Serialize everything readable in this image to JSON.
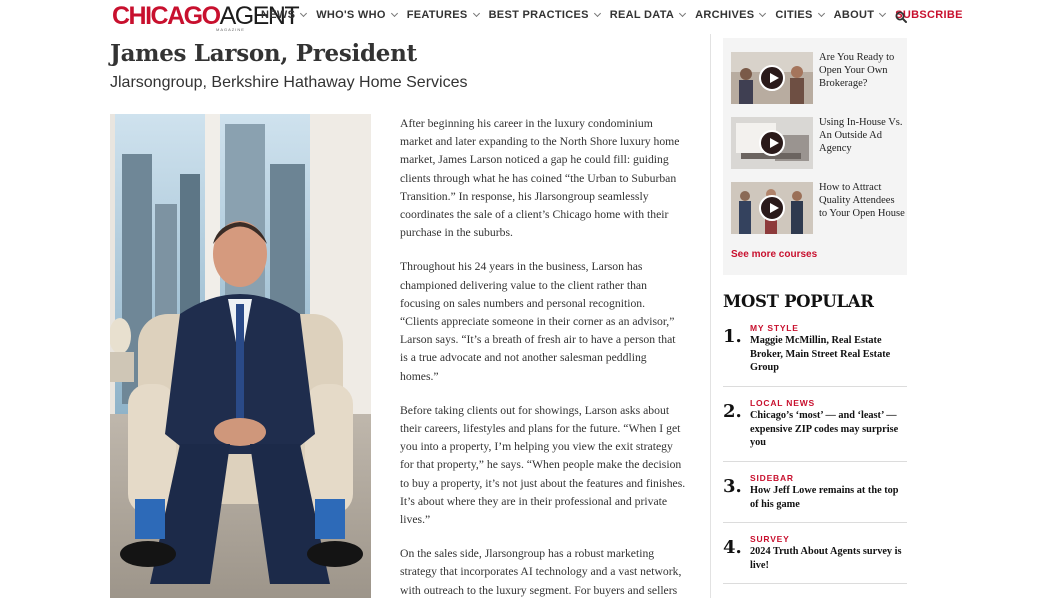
{
  "header": {
    "logo_part1": "CHICAGO",
    "logo_part2": "AGENT",
    "logo_sub": "MAGAZINE",
    "nav": [
      {
        "label": "NEWS"
      },
      {
        "label": "WHO'S WHO"
      },
      {
        "label": "FEATURES"
      },
      {
        "label": "BEST PRACTICES"
      },
      {
        "label": "REAL DATA"
      },
      {
        "label": "ARCHIVES"
      },
      {
        "label": "CITIES"
      },
      {
        "label": "ABOUT"
      },
      {
        "label": "SUBSCRIBE"
      }
    ],
    "search_icon": "search-icon"
  },
  "article": {
    "title": "James Larson, President",
    "subtitle": "Jlarsongroup, Berkshire Hathaway Home Services",
    "paragraphs": [
      "After beginning his career in the luxury condominium market and later expanding to the North Shore luxury home market, James Larson noticed a gap he could fill: guiding clients through what he has coined “the Urban to Suburban Transition.” In response, his Jlarsongroup seamlessly coordinates the sale of a client’s Chicago home with their purchase in the suburbs.",
      "Throughout his 24 years in the business, Larson has championed delivering value to the client rather than focusing on sales numbers and personal recognition. “Clients appreciate someone in their corner as an advisor,” Larson says. “It’s a breath of fresh air to have a person that is a true advocate and not another salesman peddling homes.”",
      "Before taking clients out for showings, Larson asks about their careers, lifestyles and plans for the future. “When I get you into a property, I’m helping you view the exit strategy for that property,” he says. “When people make the decision to buy a property, it’s not just about the features and finishes. It’s about where they are in their professional and private lives.”",
      "On the sales side, Jlarsongroup has a robust marketing strategy that incorporates AI technology and a vast network, with outreach to the luxury segment. For buyers and sellers"
    ]
  },
  "sidebar": {
    "courses": [
      {
        "title": "Are You Ready to Open Your Own Brokerage?"
      },
      {
        "title": "Using In-House Vs. An Outside Ad Agency"
      },
      {
        "title": "How to Attract Quality Attendees to Your Open House"
      }
    ],
    "see_more": "See more courses",
    "most_popular_title": "MOST POPULAR",
    "most_popular": [
      {
        "num": "1.",
        "category": "MY STYLE",
        "headline": "Maggie McMillin, Real Estate Broker, Main Street Real Estate Group"
      },
      {
        "num": "2.",
        "category": "LOCAL NEWS",
        "headline": "Chicago’s ‘most’ — and ‘least’ — expensive ZIP codes may surprise you"
      },
      {
        "num": "3.",
        "category": "SIDEBAR",
        "headline": "How Jeff Lowe remains at the top of his game"
      },
      {
        "num": "4.",
        "category": "SURVEY",
        "headline": "2024 Truth About Agents survey is live!"
      }
    ]
  },
  "colors": {
    "brand_red": "#c8102e",
    "text": "#333333",
    "rail_bg": "#f4f4f4"
  }
}
